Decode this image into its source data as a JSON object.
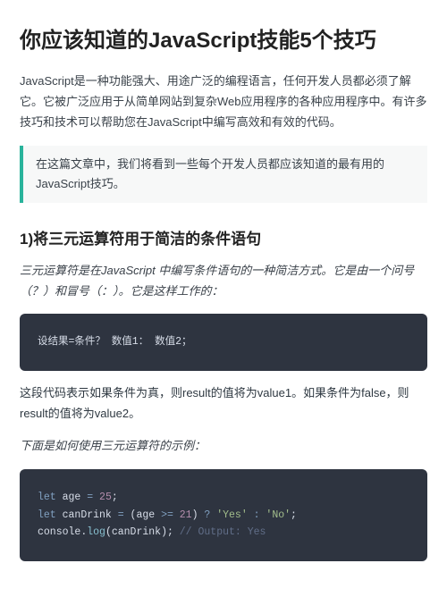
{
  "title": "你应该知道的JavaScript技能5个技巧",
  "intro": "JavaScript是一种功能强大、用途广泛的编程语言，任何开发人员都必须了解它。它被广泛应用于从简单网站到复杂Web应用程序的各种应用程序中。有许多技巧和技术可以帮助您在JavaScript中编写高效和有效的代码。",
  "callout": "在这篇文章中，我们将看到一些每个开发人员都应该知道的最有用的JavaScript技巧。",
  "section1": {
    "heading": "1)将三元运算符用于简洁的条件语句",
    "lead": "三元运算符是在JavaScript 中编写条件语句的一种简洁方式。它是由一个问号（？）和冒号（：）。它是这样工作的：",
    "code_simple": "设结果=条件？ 数值1： 数值2；",
    "explain": "这段代码表示如果条件为真，则result的值将为value1。如果条件为false，则result的值将为value2。",
    "lead2": "下面是如何使用三元运算符的示例：",
    "code_example": {
      "l1_kw": "let",
      "l1_var": " age ",
      "l1_op": "=",
      "l1_num": " 25",
      "l1_end": ";",
      "l2_kw": "let",
      "l2_var": " canDrink ",
      "l2_op1": "=",
      "l2_paren1": " (",
      "l2_exp": "age ",
      "l2_op2": ">=",
      "l2_num": " 21",
      "l2_paren2": ") ",
      "l2_q": "?",
      "l2_s1": " 'Yes' ",
      "l2_colon": ":",
      "l2_s2": " 'No'",
      "l2_end": ";",
      "l3_obj": "console",
      "l3_dot": ".",
      "l3_fn": "log",
      "l3_p1": "(",
      "l3_arg": "canDrink",
      "l3_p2": "); ",
      "l3_cm": "// Output: Yes"
    }
  }
}
